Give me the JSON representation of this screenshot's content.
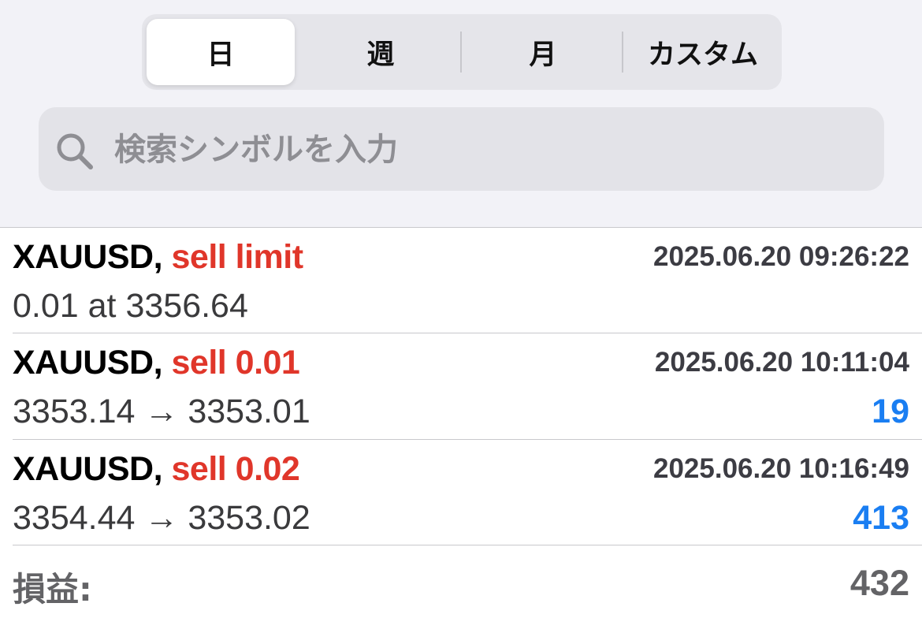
{
  "segments": [
    {
      "label": "日",
      "active": true
    },
    {
      "label": "週",
      "active": false
    },
    {
      "label": "月",
      "active": false
    },
    {
      "label": "カスタム",
      "active": false
    }
  ],
  "search": {
    "placeholder": "検索シンボルを入力",
    "icon": "search-icon"
  },
  "rows": [
    {
      "symbol": "XAUUSD,",
      "action": "sell limit",
      "time": "2025.06.20 09:26:22",
      "detail": "0.01 at 3356.64",
      "profit": ""
    },
    {
      "symbol": "XAUUSD,",
      "action": "sell 0.01",
      "time": "2025.06.20 10:11:04",
      "detail": "3353.14 → 3353.01",
      "profit": "19"
    },
    {
      "symbol": "XAUUSD,",
      "action": "sell 0.02",
      "time": "2025.06.20 10:16:49",
      "detail": "3354.44 → 3353.02",
      "profit": "413"
    }
  ],
  "summary": {
    "label": "損益:",
    "value": "432"
  },
  "colors": {
    "sell": "#e0362a",
    "profit": "#1a7ef2",
    "background": "#f2f2f7"
  }
}
